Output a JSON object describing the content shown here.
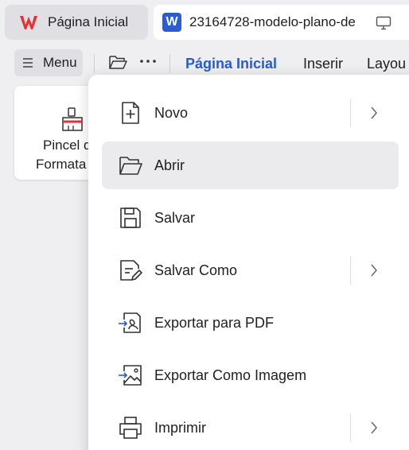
{
  "tabs": {
    "home_label": "Página Inicial",
    "doc_label": "23164728-modelo-plano-de",
    "doc_icon_letter": "W"
  },
  "toolbar": {
    "menu_label": "Menu",
    "ribbon_tabs": [
      "Página Inicial",
      "Inserir",
      "Layou"
    ]
  },
  "ribbon": {
    "format_painter_line1": "Pincel d",
    "format_painter_line2": "Formata"
  },
  "menu": {
    "items": [
      {
        "label": "Novo",
        "icon": "new-file-icon",
        "submenu": true
      },
      {
        "label": "Abrir",
        "icon": "open-folder-icon",
        "submenu": false
      },
      {
        "label": "Salvar",
        "icon": "save-icon",
        "submenu": false
      },
      {
        "label": "Salvar Como",
        "icon": "save-as-icon",
        "submenu": true
      },
      {
        "label": "Exportar para PDF",
        "icon": "export-pdf-icon",
        "submenu": false
      },
      {
        "label": "Exportar Como Imagem",
        "icon": "export-image-icon",
        "submenu": false
      },
      {
        "label": "Imprimir",
        "icon": "print-icon",
        "submenu": true
      }
    ]
  },
  "colors": {
    "accent": "#2a5bcd",
    "wps_red": "#e8312f",
    "hover": "#ebebed"
  }
}
